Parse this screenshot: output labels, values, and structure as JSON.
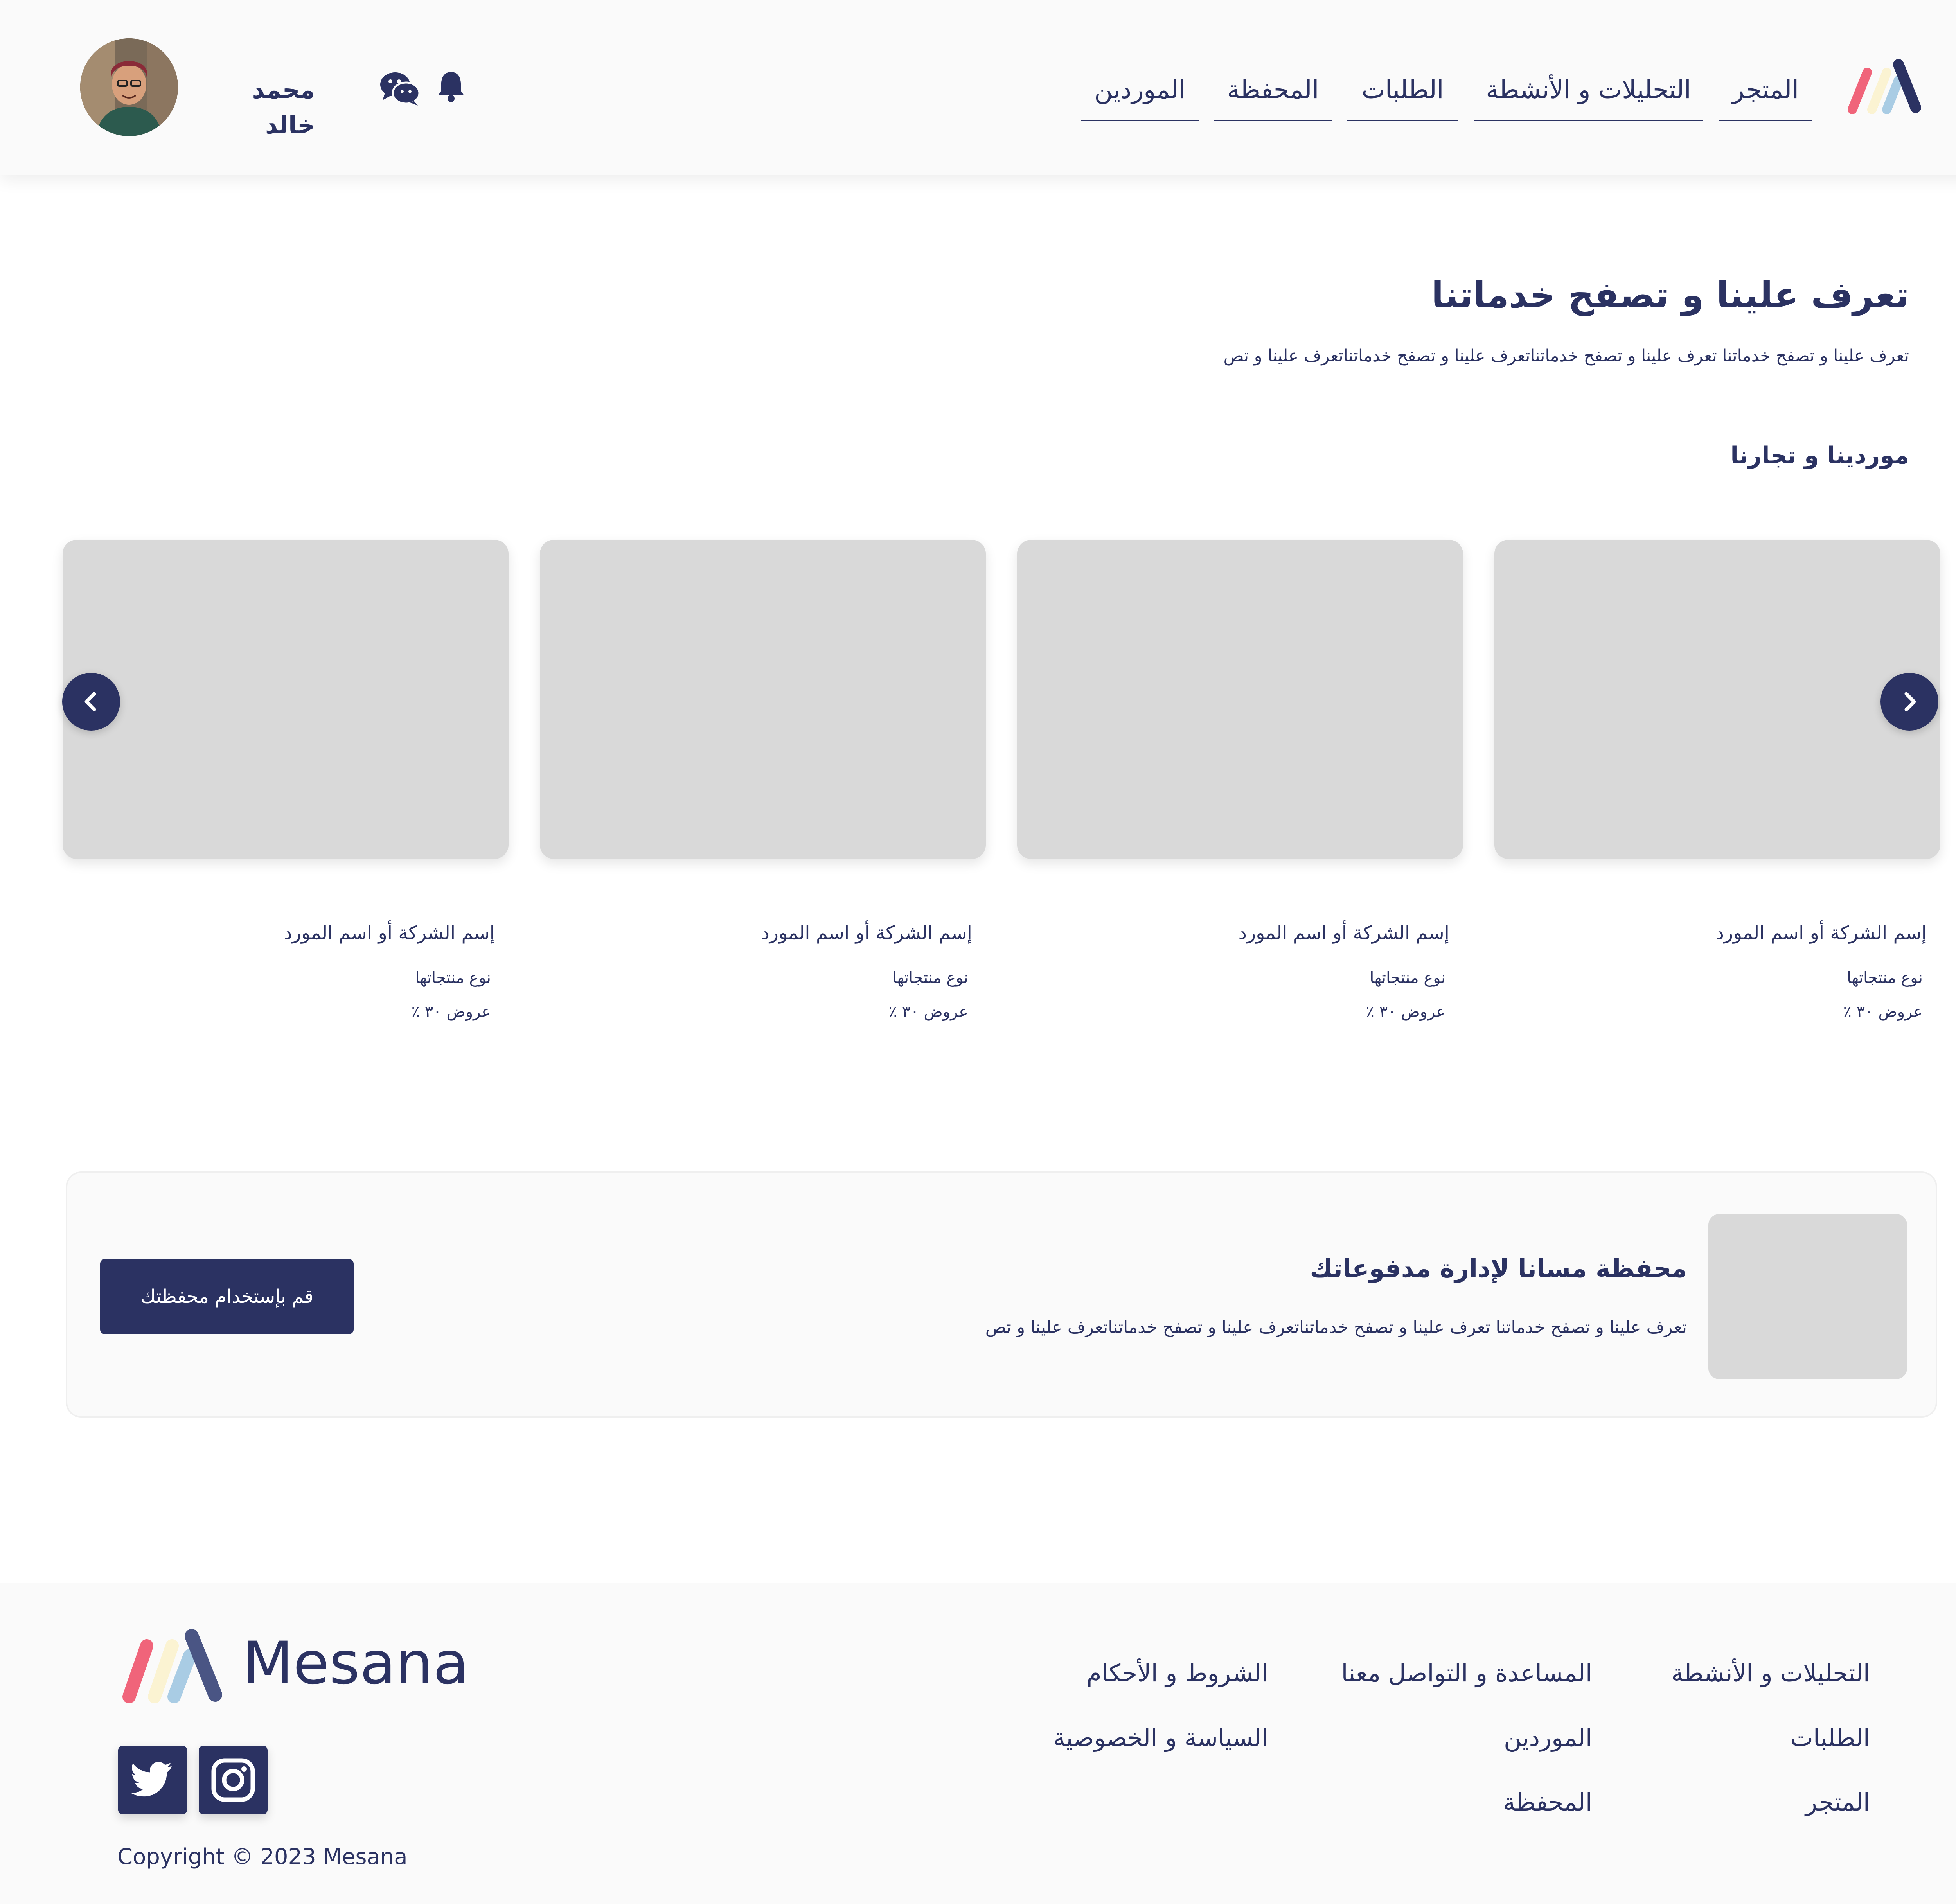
{
  "colors": {
    "primary": "#2b3262",
    "placeholder": "#d9d9d9",
    "background": "#fafafa",
    "logo_red": "#f0647a",
    "logo_blue": "#a9cce4",
    "logo_cream": "#fbf3d2"
  },
  "header": {
    "logo_icon": "mesana-logo-icon",
    "nav": [
      {
        "label": "المتجر"
      },
      {
        "label": "التحليلات و الأنشطة"
      },
      {
        "label": "الطلبات"
      },
      {
        "label": "المحفظة"
      },
      {
        "label": "الموردين"
      }
    ],
    "notification_icon": "bell-icon",
    "chat_icon": "wechat-icon",
    "user_name": "محمد خالد",
    "avatar_icon": "user-avatar-photo"
  },
  "hero": {
    "title": "تعرف علينا و تصفح خدماتنا",
    "subtitle": "تعرف علينا و تصفح خدماتنا تعرف علينا و تصفح خدماتناتعرف علينا و تصفح خدماتناتعرف علينا و تص"
  },
  "suppliers": {
    "title": "موردينا و تجارنا",
    "prev_icon": "chevron-left-icon",
    "next_icon": "chevron-right-icon",
    "cards": [
      {
        "name": "إسم الشركة أو اسم المورد",
        "type": "نوع منتجاتها",
        "offer": "عروض ٣٠ ٪"
      },
      {
        "name": "إسم الشركة أو اسم المورد",
        "type": "نوع منتجاتها",
        "offer": "عروض ٣٠ ٪"
      },
      {
        "name": "إسم الشركة أو اسم المورد",
        "type": "نوع منتجاتها",
        "offer": "عروض ٣٠ ٪"
      },
      {
        "name": "إسم الشركة أو اسم المورد",
        "type": "نوع منتجاتها",
        "offer": "عروض ٣٠ ٪"
      }
    ]
  },
  "wallet": {
    "title": "محفظة مسانا لإدارة مدفوعاتك",
    "text": "تعرف علينا و تصفح خدماتنا تعرف علينا و تصفح خدماتناتعرف علينا و تصفح خدماتناتعرف علينا و تص",
    "button": "قم بإستخدام محفظتك"
  },
  "footer": {
    "brand": "Mesana",
    "links_col1": [
      "التحليلات و الأنشطة",
      "الطلبات",
      "المتجر"
    ],
    "links_col2": [
      "المساعدة و التواصل معنا",
      "الموردين",
      "المحفظة"
    ],
    "links_col3": [
      "الشروط و الأحكام",
      "السياسة و الخصوصية"
    ],
    "social_icons": [
      "instagram-icon",
      "twitter-icon"
    ],
    "copyright": "Copyright © 2023  Mesana"
  }
}
